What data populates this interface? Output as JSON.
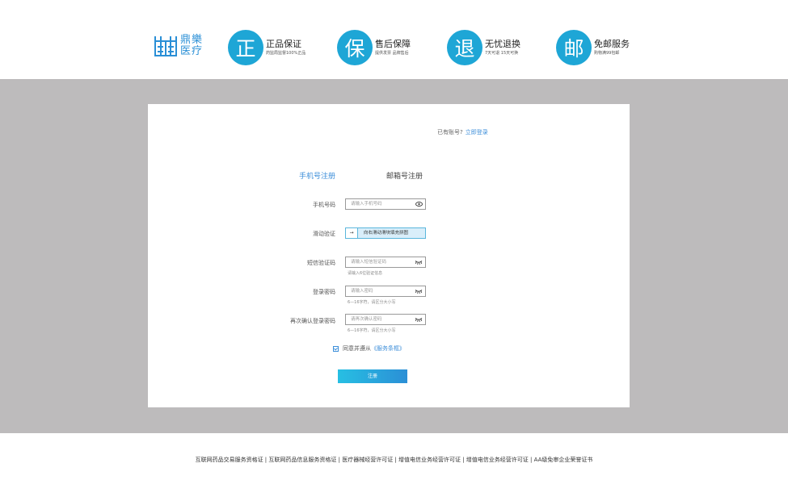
{
  "header": {
    "logo_line1": "鼎樂",
    "logo_line2": "医疗",
    "features": [
      {
        "glyph": "正",
        "title": "正品保证",
        "sub": "药监局监督100%正品"
      },
      {
        "glyph": "保",
        "title": "售后保障",
        "sub": "提供发票 品牌售后"
      },
      {
        "glyph": "退",
        "title": "无忧退换",
        "sub": "7天可退 15天可换"
      },
      {
        "glyph": "邮",
        "title": "免邮服务",
        "sub": "购物满99包邮"
      }
    ]
  },
  "card": {
    "login_prompt": "已有账号?",
    "login_link": "立即登录",
    "tabs": {
      "phone": "手机号注册",
      "email": "邮箱号注册"
    },
    "fields": {
      "phone": {
        "label": "手机号码",
        "placeholder": "请输入手机号码"
      },
      "slider": {
        "label": "滑动验证",
        "arrow": "→",
        "text": "向右滑动滑块填充拼图"
      },
      "sms": {
        "label": "短信验证码",
        "placeholder": "请输入短信验证码",
        "hint": "请输入6位验证信息"
      },
      "password": {
        "label": "登录密码",
        "placeholder": "请输入密码",
        "hint": "6—16字符，请区分大小写"
      },
      "confirm": {
        "label": "再次确认登录密码",
        "placeholder": "请再次确认密码",
        "hint": "6—16字符，请区分大小写"
      }
    },
    "agree_text": "同意并遵从",
    "terms": "《服务条框》",
    "submit": "注册"
  },
  "footer": {
    "text": "互联网药品交易服务资格证 | 互联网药品信息服务资格证 | 医疗器械经营许可证 | 增值电信业务经营许可证 | 增值电信业务经营许可证 | AA级免审企业荣誉证书"
  },
  "colors": {
    "accent": "#1ea6d6",
    "link": "#3c8ed9",
    "band": "#bdbbbc"
  }
}
